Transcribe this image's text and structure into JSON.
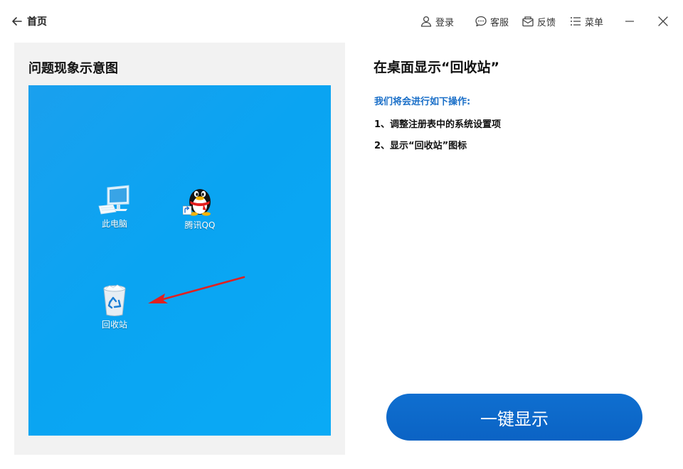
{
  "header": {
    "home_label": "首页",
    "actions": {
      "login": "登录",
      "service": "客服",
      "feedback": "反馈",
      "menu": "菜单"
    }
  },
  "left": {
    "title": "问题现象示意图",
    "desktop_icons": {
      "pc": "此电脑",
      "qq": "腾讯QQ",
      "recycle_bin": "回收站"
    }
  },
  "right": {
    "title": "在桌面显示“回收站”",
    "ops_label": "我们将会进行如下操作:",
    "steps": [
      "1、调整注册表中的系统设置项",
      "2、显示“回收站”图标"
    ],
    "primary_button": "一键显示"
  },
  "colors": {
    "accent": "#0b63c4",
    "ops_label": "#1a6fc8",
    "desktop": "#0aa4f2",
    "arrow": "#e02020"
  }
}
